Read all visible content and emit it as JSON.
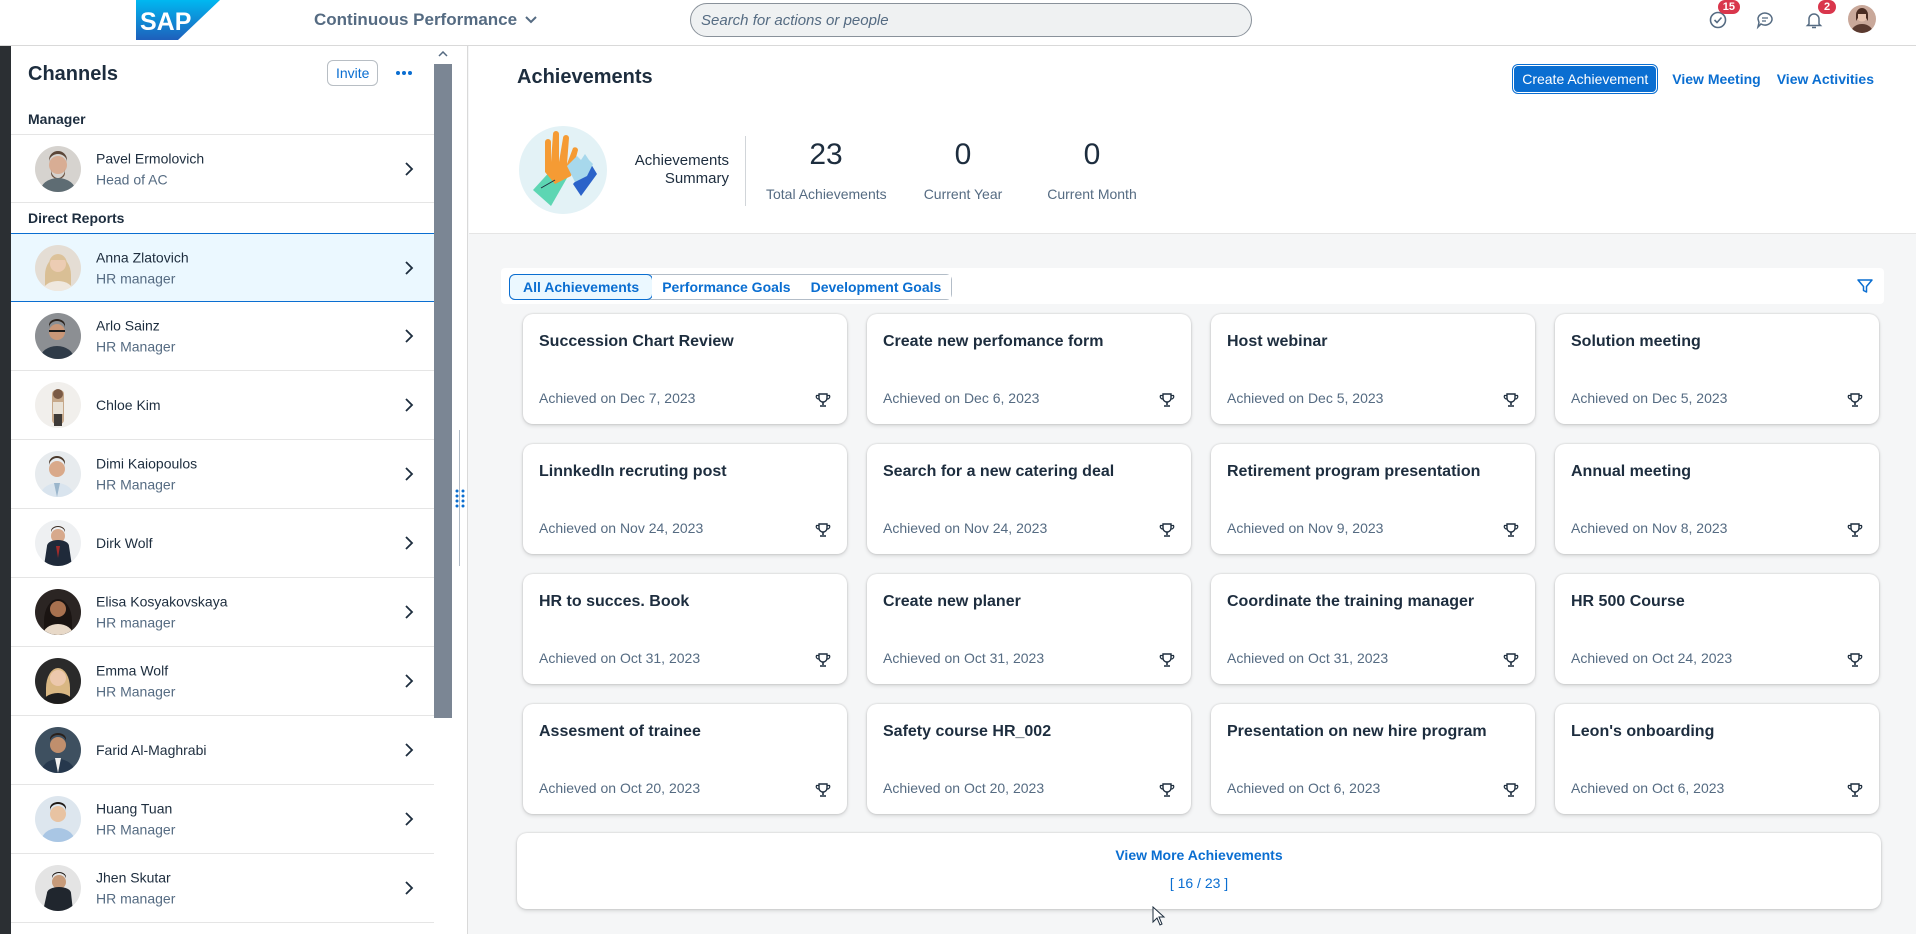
{
  "shell": {
    "logo_text": "SAP",
    "app_title": "Continuous Performance",
    "search_placeholder": "Search for actions or people",
    "icons": [
      {
        "name": "tasks-icon",
        "badge": "15"
      },
      {
        "name": "chat-icon",
        "badge": ""
      },
      {
        "name": "notifications-icon",
        "badge": "2"
      }
    ],
    "accent": "#0a6ed1",
    "badge_color": "#d9364c"
  },
  "sidebar": {
    "title": "Channels",
    "invite_label": "Invite",
    "manager_section": "Manager",
    "direct_section": "Direct Reports",
    "manager": {
      "name": "Pavel Ermolovich",
      "role": "Head of AC"
    },
    "reports": [
      {
        "name": "Anna Zlatovich",
        "role": "HR manager",
        "selected": true
      },
      {
        "name": "Arlo Sainz",
        "role": "HR Manager"
      },
      {
        "name": "Chloe Kim",
        "role": ""
      },
      {
        "name": "Dimi Kaiopoulos",
        "role": "HR Manager"
      },
      {
        "name": "Dirk Wolf",
        "role": ""
      },
      {
        "name": "Elisa Kosyakovskaya",
        "role": "HR manager"
      },
      {
        "name": "Emma Wolf",
        "role": "HR Manager"
      },
      {
        "name": "Farid Al-Maghrabi",
        "role": ""
      },
      {
        "name": "Huang Tuan",
        "role": "HR Manager"
      },
      {
        "name": "Jhen Skutar",
        "role": "HR manager"
      }
    ]
  },
  "main": {
    "title": "Achievements",
    "actions": {
      "create": "Create Achievement",
      "view_meeting": "View Meeting",
      "view_activities": "View Activities"
    },
    "summary": {
      "label_line1": "Achievements",
      "label_line2": "Summary",
      "kpis": [
        {
          "value": "23",
          "label": "Total Achievements"
        },
        {
          "value": "0",
          "label": "Current Year"
        },
        {
          "value": "0",
          "label": "Current Month"
        }
      ]
    },
    "tabs": [
      "All Achievements",
      "Performance Goals",
      "Development Goals"
    ],
    "active_tab": "All Achievements",
    "achievements": [
      {
        "title": "Succession Chart Review",
        "date": "Achieved on Dec 7, 2023"
      },
      {
        "title": "Create new perfomance form",
        "date": "Achieved on Dec 6, 2023"
      },
      {
        "title": "Host webinar",
        "date": "Achieved on Dec 5, 2023"
      },
      {
        "title": "Solution meeting",
        "date": "Achieved on Dec 5, 2023"
      },
      {
        "title": "LinnkedIn recruting post",
        "date": "Achieved on Nov 24, 2023"
      },
      {
        "title": "Search for a new catering deal",
        "date": "Achieved on Nov 24, 2023"
      },
      {
        "title": "Retirement program presentation",
        "date": "Achieved on Nov 9, 2023"
      },
      {
        "title": "Annual meeting",
        "date": "Achieved on Nov 8, 2023"
      },
      {
        "title": "HR to succes. Book",
        "date": "Achieved on Oct 31, 2023"
      },
      {
        "title": "Create new planer",
        "date": "Achieved on Oct 31, 2023"
      },
      {
        "title": "Coordinate the training manager",
        "date": "Achieved on Oct 31, 2023"
      },
      {
        "title": "HR 500 Course",
        "date": "Achieved on Oct 24, 2023"
      },
      {
        "title": "Assesment of trainee",
        "date": "Achieved on Oct 20, 2023"
      },
      {
        "title": "Safety course HR_002",
        "date": "Achieved on Oct 20, 2023"
      },
      {
        "title": "Presentation on new hire program",
        "date": "Achieved on Oct 6, 2023"
      },
      {
        "title": "Leon's onboarding",
        "date": "Achieved on Oct 6, 2023"
      }
    ],
    "view_more": {
      "label": "View More Achievements",
      "count": "[ 16 / 23 ]"
    }
  }
}
